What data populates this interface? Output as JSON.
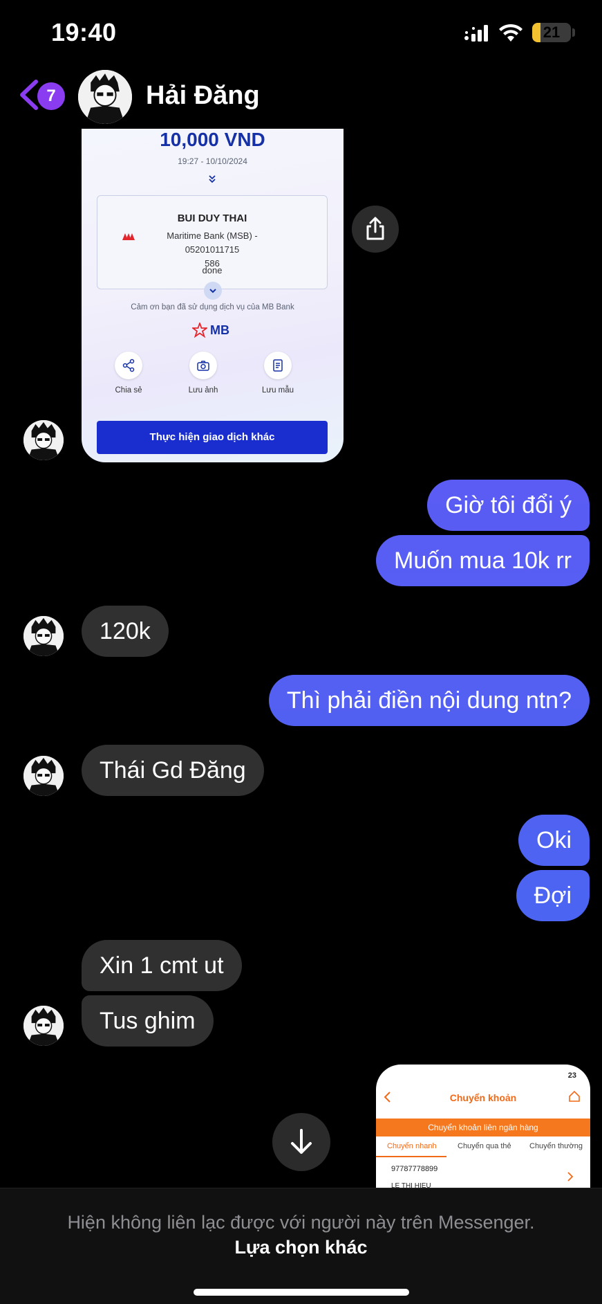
{
  "status_bar": {
    "time": "19:40",
    "battery": "21",
    "battery_level": 0.21,
    "battery_color": "#f2c230"
  },
  "header": {
    "unread_count": "7",
    "contact_name": "Hải Đăng",
    "accent": "#8a3cf0"
  },
  "receipt": {
    "amount": "10,000 VND",
    "datetime": "19:27 - 10/10/2024",
    "recipient": "BUI DUY THAI",
    "bank_line1": "Maritime Bank (MSB) - 05201011715",
    "bank_line2": "586",
    "status": "done",
    "thanks": "Cảm ơn bạn đã sử dụng dịch vụ của MB Bank",
    "bank_logo_text": "MB",
    "actions": [
      "Chia sẻ",
      "Lưu ảnh",
      "Lưu mẫu"
    ],
    "cta": "Thực hiện giao dịch khác"
  },
  "messages": [
    {
      "from": "me",
      "text": "Giờ tôi đổi ý"
    },
    {
      "from": "me",
      "text": "Muốn mua 10k rr"
    },
    {
      "from": "them",
      "text": "120k"
    },
    {
      "from": "me",
      "text": "Thì phải điền nội dung ntn?"
    },
    {
      "from": "them",
      "text": "Thái Gd Đăng"
    },
    {
      "from": "me",
      "text": "Oki"
    },
    {
      "from": "me",
      "text": "Đợi"
    },
    {
      "from": "them",
      "text": "Xin 1 cmt ut"
    },
    {
      "from": "them",
      "text": "Tus ghim"
    }
  ],
  "bubble_colors": {
    "gradient_top": "#6a52f5",
    "gradient_bottom": "#3f6cf0",
    "incoming": "#303030"
  },
  "bank_preview": {
    "status_text": "23",
    "title": "Chuyển khoản",
    "banner": "Chuyển khoản liên ngân hàng",
    "tabs": [
      "Chuyển nhanh",
      "Chuyển qua thẻ",
      "Chuyển thường"
    ],
    "account": "97787778899",
    "name": "LE THI HIEU"
  },
  "footer": {
    "message": "Hiện không liên lạc được với người này trên Messenger.",
    "link": "Lựa chọn khác"
  }
}
